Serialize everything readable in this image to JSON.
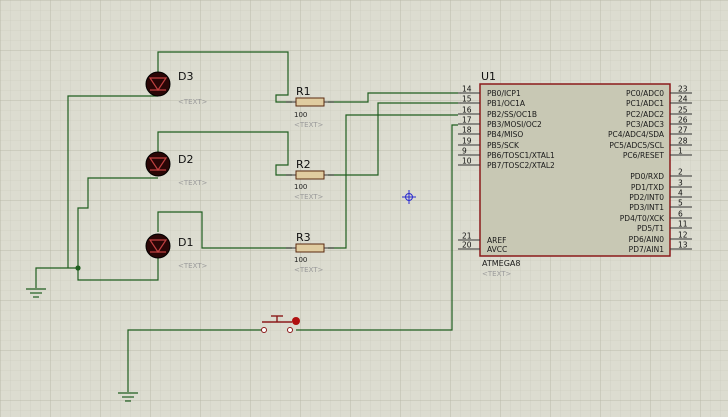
{
  "colors": {
    "background": "#dcdcd0",
    "grid_minor": "#c8c8ba",
    "grid_major": "#b4b4a4",
    "wire": "#1f5e1f",
    "chip_fill": "#c8c8b4",
    "chip_border": "#8b1a1a",
    "resistor_fill": "#e0cca0",
    "led_body": "#2a0606",
    "marker": "#2a2ad0"
  },
  "chip": {
    "ref": "U1",
    "part": "ATMEGA8",
    "text": "<TEXT>",
    "left_pins": [
      {
        "num": "14",
        "name": "PB0/ICP1"
      },
      {
        "num": "15",
        "name": "PB1/OC1A"
      },
      {
        "num": "16",
        "name": "PB2/SS/OC1B"
      },
      {
        "num": "17",
        "name": "PB3/MOSI/OC2"
      },
      {
        "num": "18",
        "name": "PB4/MISO"
      },
      {
        "num": "19",
        "name": "PB5/SCK"
      },
      {
        "num": "9",
        "name": "PB6/TOSC1/XTAL1"
      },
      {
        "num": "10",
        "name": "PB7/TOSC2/XTAL2"
      },
      {
        "num": "21",
        "name": "AREF"
      },
      {
        "num": "20",
        "name": "AVCC"
      }
    ],
    "right_pins": [
      {
        "num": "23",
        "name": "PC0/ADC0"
      },
      {
        "num": "24",
        "name": "PC1/ADC1"
      },
      {
        "num": "25",
        "name": "PC2/ADC2"
      },
      {
        "num": "26",
        "name": "PC3/ADC3"
      },
      {
        "num": "27",
        "name": "PC4/ADC4/SDA"
      },
      {
        "num": "28",
        "name": "PC5/ADC5/SCL"
      },
      {
        "num": "1",
        "name": "PC6/RESET"
      },
      {
        "num": "2",
        "name": "PD0/RXD"
      },
      {
        "num": "3",
        "name": "PD1/TXD"
      },
      {
        "num": "4",
        "name": "PD2/INT0"
      },
      {
        "num": "5",
        "name": "PD3/INT1"
      },
      {
        "num": "6",
        "name": "PD4/T0/XCK"
      },
      {
        "num": "11",
        "name": "PD5/T1"
      },
      {
        "num": "12",
        "name": "PD6/AIN0"
      },
      {
        "num": "13",
        "name": "PD7/AIN1"
      }
    ]
  },
  "leds": [
    {
      "ref": "D3",
      "text": "<TEXT>"
    },
    {
      "ref": "D2",
      "text": "<TEXT>"
    },
    {
      "ref": "D1",
      "text": "<TEXT>"
    }
  ],
  "resistors": [
    {
      "ref": "R1",
      "value": "100",
      "text": "<TEXT>"
    },
    {
      "ref": "R2",
      "value": "100",
      "text": "<TEXT>"
    },
    {
      "ref": "R3",
      "value": "100",
      "text": "<TEXT>"
    }
  ]
}
